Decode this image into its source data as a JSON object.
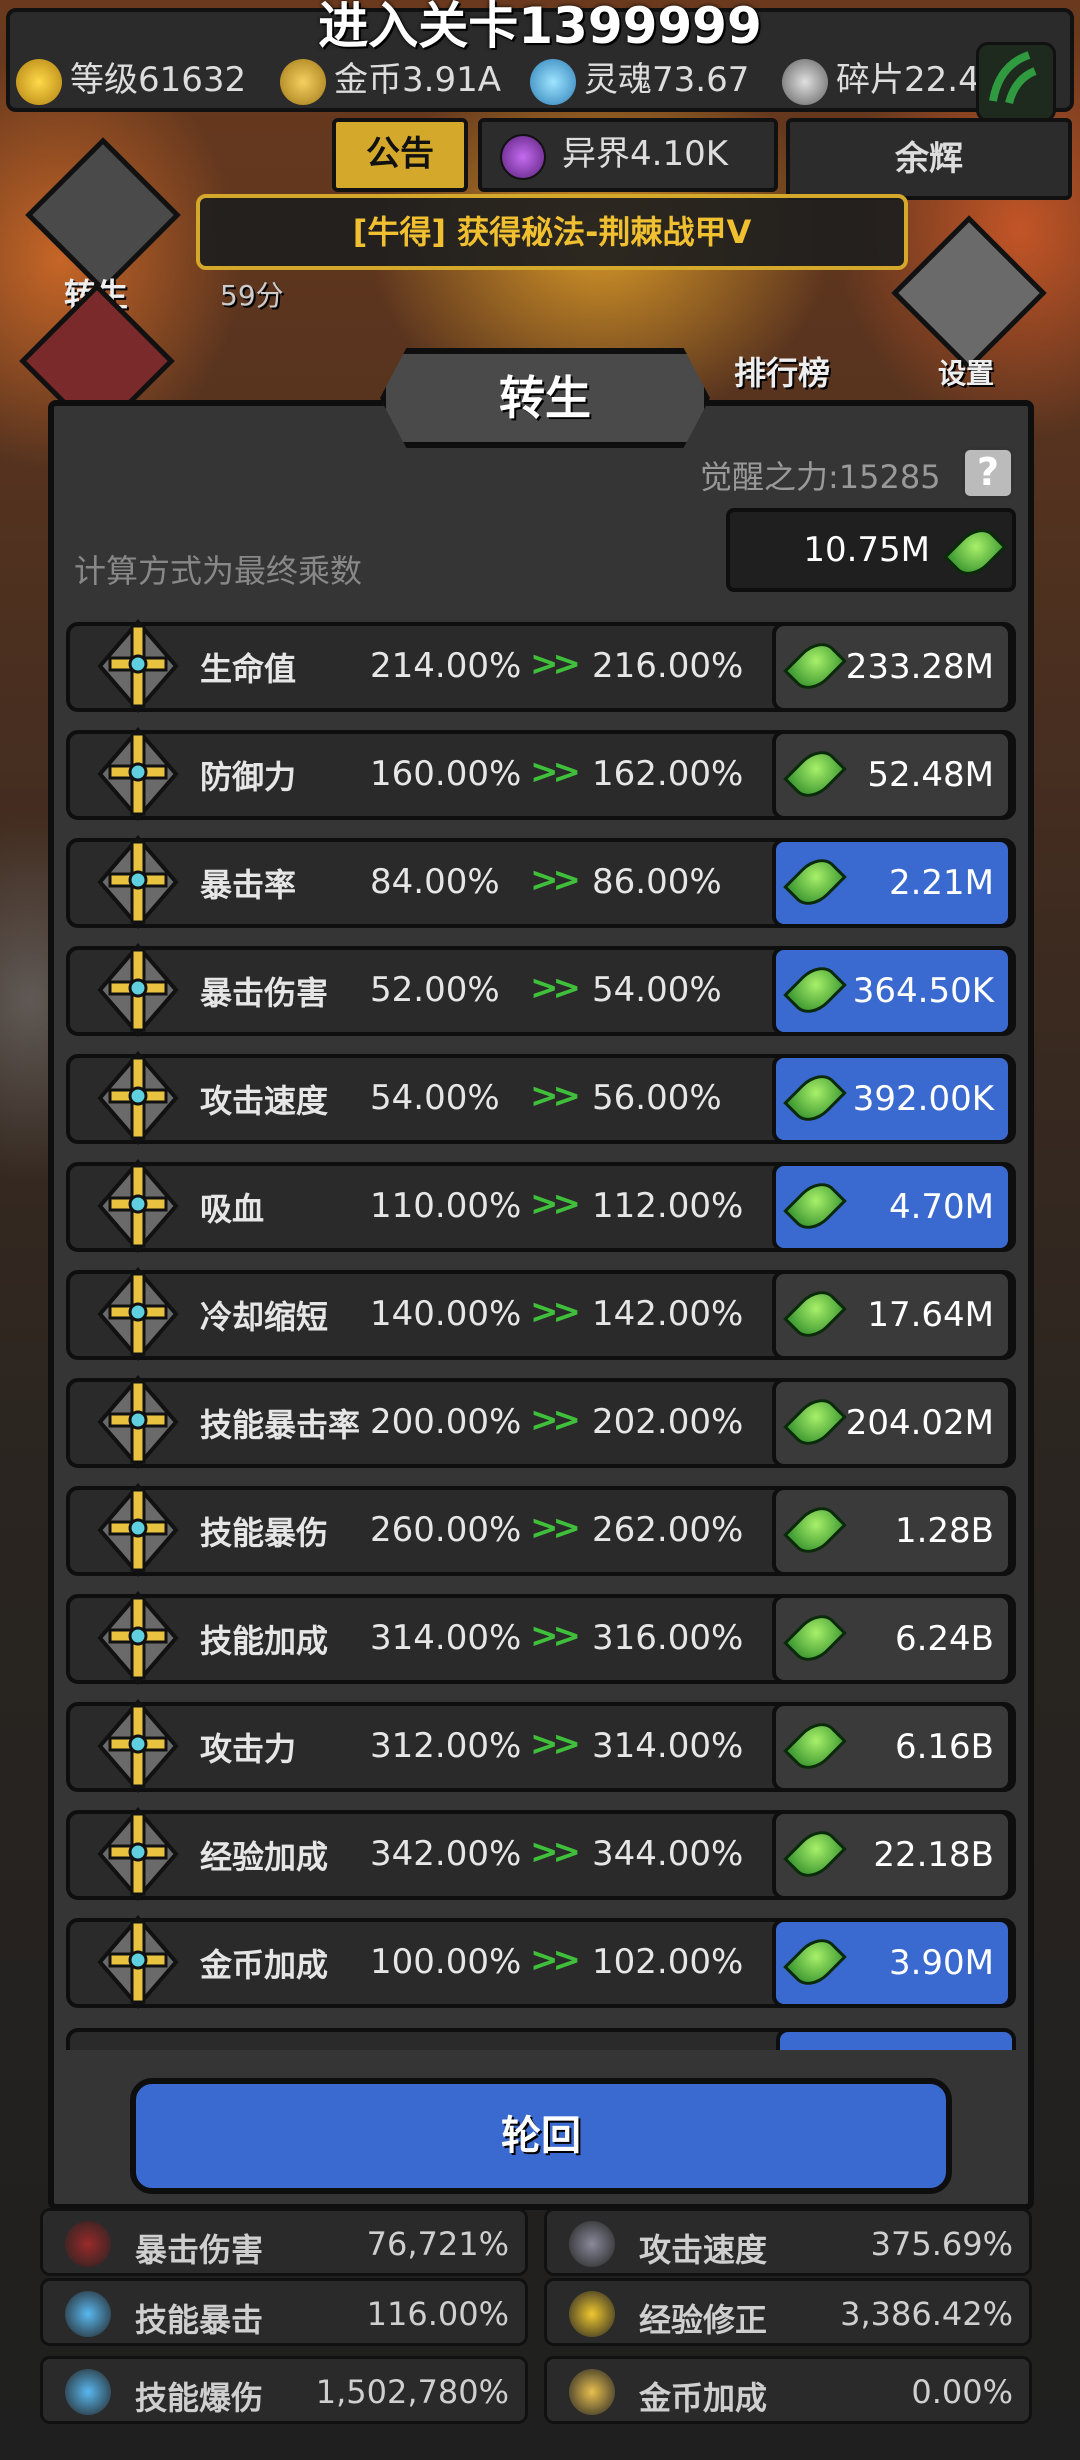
{
  "header": {
    "stage_title": "进入关卡1399999",
    "resources": [
      {
        "label": "等级61632",
        "icon": "crown-icon"
      },
      {
        "label": "金币3.91A",
        "icon": "gold-coin-icon"
      },
      {
        "label": "灵魂73.67",
        "icon": "soul-flame-icon"
      },
      {
        "label": "碎片22.4",
        "icon": "shard-icon"
      }
    ]
  },
  "tabs": {
    "notice": "公告",
    "otherworld": "异界4.10K",
    "afterglow": "余辉"
  },
  "banner": "[牛得] 获得秘法-荆棘战甲V",
  "side": {
    "rebirth_label": "转生",
    "rebirth_value": "59分",
    "ranking_label": "排行榜",
    "settings_label": "设置"
  },
  "panel": {
    "title": "转生",
    "awaken_power": "觉醒之力:15285",
    "help": "?",
    "calc_note": "计算方式为最终乘数",
    "currency": "10.75M",
    "arrow": ">>",
    "rows": [
      {
        "name": "生命值",
        "from": "214.00%",
        "to": "216.00%",
        "cost": "233.28M",
        "active": false
      },
      {
        "name": "防御力",
        "from": "160.00%",
        "to": "162.00%",
        "cost": "52.48M",
        "active": false
      },
      {
        "name": "暴击率",
        "from": "84.00%",
        "to": "86.00%",
        "cost": "2.21M",
        "active": true
      },
      {
        "name": "暴击伤害",
        "from": "52.00%",
        "to": "54.00%",
        "cost": "364.50K",
        "active": true
      },
      {
        "name": "攻击速度",
        "from": "54.00%",
        "to": "56.00%",
        "cost": "392.00K",
        "active": true
      },
      {
        "name": "吸血",
        "from": "110.00%",
        "to": "112.00%",
        "cost": "4.70M",
        "active": true
      },
      {
        "name": "冷却缩短",
        "from": "140.00%",
        "to": "142.00%",
        "cost": "17.64M",
        "active": false
      },
      {
        "name": "技能暴击率",
        "from": "200.00%",
        "to": "202.00%",
        "cost": "204.02M",
        "active": false
      },
      {
        "name": "技能暴伤",
        "from": "260.00%",
        "to": "262.00%",
        "cost": "1.28B",
        "active": false
      },
      {
        "name": "技能加成",
        "from": "314.00%",
        "to": "316.00%",
        "cost": "6.24B",
        "active": false
      },
      {
        "name": "攻击力",
        "from": "312.00%",
        "to": "314.00%",
        "cost": "6.16B",
        "active": false
      },
      {
        "name": "经验加成",
        "from": "342.00%",
        "to": "344.00%",
        "cost": "22.18B",
        "active": false
      },
      {
        "name": "金币加成",
        "from": "100.00%",
        "to": "102.00%",
        "cost": "3.90M",
        "active": true
      }
    ],
    "rebirth_button": "轮回"
  },
  "stats": [
    {
      "name": "暴击伤害",
      "value": "76,721%",
      "icon": "crit-damage-icon"
    },
    {
      "name": "攻击速度",
      "value": "375.69%",
      "icon": "swords-icon"
    },
    {
      "name": "技能暴击",
      "value": "116.00%",
      "icon": "blue-flame-icon"
    },
    {
      "name": "经验修正",
      "value": "3,386.42%",
      "icon": "crown-icon"
    },
    {
      "name": "技能爆伤",
      "value": "1,502,780%",
      "icon": "blue-flame-icon"
    },
    {
      "name": "金币加成",
      "value": "0.00%",
      "icon": "gold-coin-icon"
    }
  ],
  "colors": {
    "accent_gold": "#d4a82a",
    "button_blue": "#3a6ad0",
    "arrow_green": "#3fbf3a"
  }
}
